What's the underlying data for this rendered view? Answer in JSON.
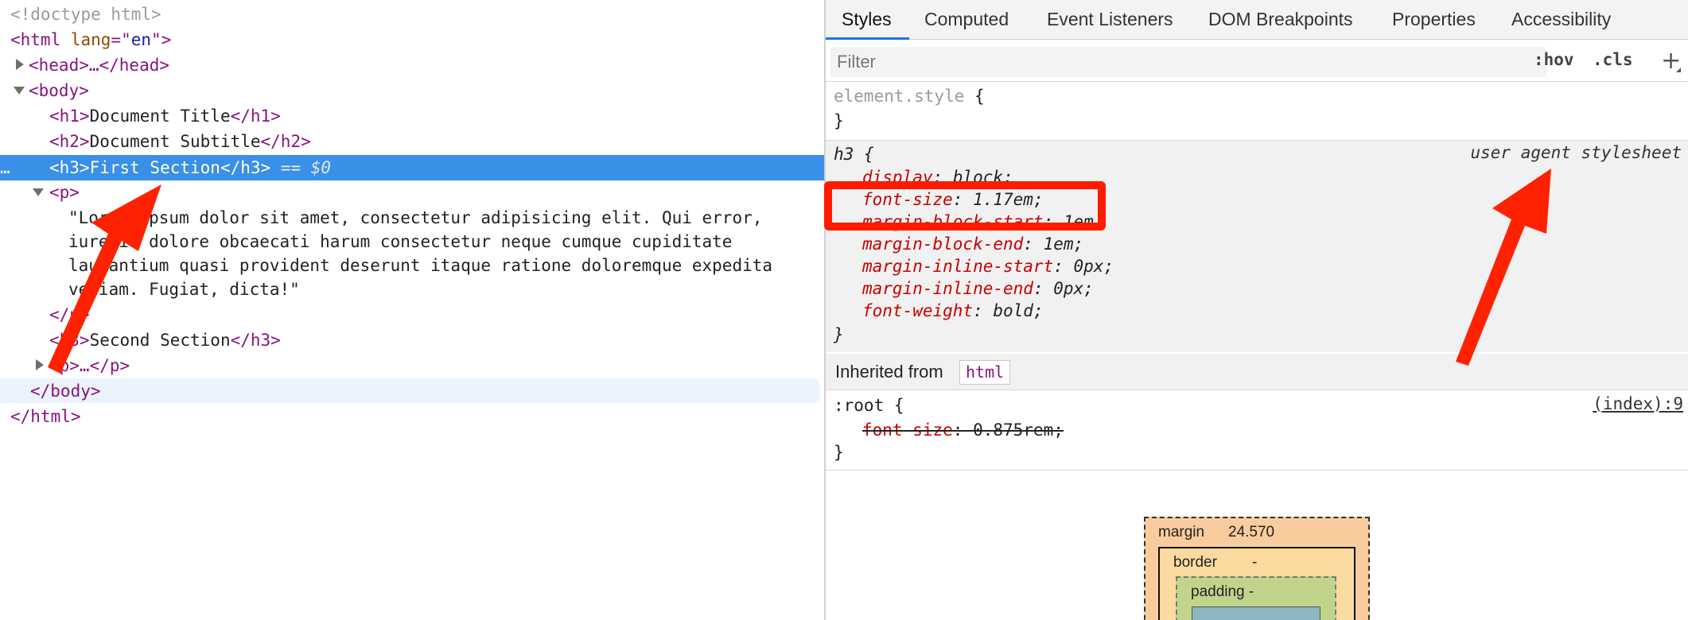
{
  "dom": {
    "doctype": "<!doctype html>",
    "html_open_tag": "<html",
    "html_attr_name": "lang",
    "html_attr_eq": "=\"",
    "html_attr_value": "en",
    "html_attr_close": "\">",
    "head_collapsed": "<head>…</head>",
    "body_open": "<body>",
    "h1_open": "<h1>",
    "h1_text": "Document Title",
    "h1_close": "</h1>",
    "h2_open": "<h2>",
    "h2_text": "Document Subtitle",
    "h2_close": "</h2>",
    "selected_dots": "…",
    "selected_h3_open": "<h3>",
    "selected_h3_text": "First Section",
    "selected_h3_close": "</h3>",
    "selected_eq": " == ",
    "selected_ref": "$0",
    "p_open": "<p>",
    "p_text_lines": [
      "\"Lorem ipsum dolor sit amet, consectetur adipisicing elit. Qui error,",
      "iure id dolore obcaecati harum consectetur neque cumque cupiditate",
      "laudantium quasi provident deserunt itaque ratione doloremque expedita",
      "veniam. Fugiat, dicta!\""
    ],
    "p_close": "</p>",
    "h3b_open": "<h3>",
    "h3b_text": "Second Section",
    "h3b_close": "</h3>",
    "p2_collapsed": "<p>…</p>",
    "body_close": "</body>",
    "html_close": "</html>"
  },
  "tabs": [
    {
      "label": "Styles",
      "active": true
    },
    {
      "label": "Computed",
      "active": false
    },
    {
      "label": "Event Listeners",
      "active": false
    },
    {
      "label": "DOM Breakpoints",
      "active": false
    },
    {
      "label": "Properties",
      "active": false
    },
    {
      "label": "Accessibility",
      "active": false
    }
  ],
  "filter": {
    "placeholder": "Filter",
    "hov": ":hov",
    "cls": ".cls",
    "plus": "+"
  },
  "element_style": {
    "selector": "element.style",
    "open": " {",
    "close": "}"
  },
  "ua_rule": {
    "selector": "h3",
    "open": " {",
    "source": "user agent stylesheet",
    "declarations": [
      {
        "prop": "display",
        "value": "block"
      },
      {
        "prop": "font-size",
        "value": "1.17em"
      },
      {
        "prop": "margin-block-start",
        "value": "1em"
      },
      {
        "prop": "margin-block-end",
        "value": "1em"
      },
      {
        "prop": "margin-inline-start",
        "value": "0px"
      },
      {
        "prop": "margin-inline-end",
        "value": "0px"
      },
      {
        "prop": "font-weight",
        "value": "bold"
      }
    ],
    "close": "}"
  },
  "inherited": {
    "label": "Inherited from",
    "tag": "html"
  },
  "root_rule": {
    "selector": ":root",
    "open": " {",
    "source": "(index):9",
    "declarations": [
      {
        "prop": "font-size",
        "value": "0.875rem",
        "overridden": true
      }
    ],
    "close": "}"
  },
  "box_model": {
    "margin_label": "margin",
    "margin_value": "24.570",
    "border_label": "border",
    "border_value": "-",
    "padding_label": "padding -"
  },
  "colors": {
    "selection": "#3a8fe6",
    "annotation": "#ff1a00",
    "property": "#c80000",
    "tag": "#881280"
  }
}
